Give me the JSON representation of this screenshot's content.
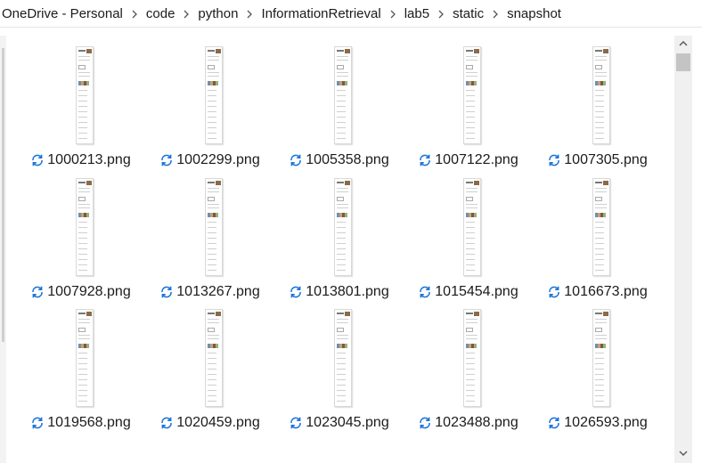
{
  "breadcrumb": {
    "items": [
      "OneDrive - Personal",
      "code",
      "python",
      "InformationRetrieval",
      "lab5",
      "static",
      "snapshot"
    ]
  },
  "files": [
    {
      "name": "1000213.png"
    },
    {
      "name": "1002299.png"
    },
    {
      "name": "1005358.png"
    },
    {
      "name": "1007122.png"
    },
    {
      "name": "1007305.png"
    },
    {
      "name": "1007928.png"
    },
    {
      "name": "1013267.png"
    },
    {
      "name": "1013801.png"
    },
    {
      "name": "1015454.png"
    },
    {
      "name": "1016673.png"
    },
    {
      "name": "1019568.png"
    },
    {
      "name": "1020459.png"
    },
    {
      "name": "1023045.png"
    },
    {
      "name": "1023488.png"
    },
    {
      "name": "1026593.png"
    }
  ],
  "icons": {
    "sync": "sync-pending-icon",
    "separator": "chevron-right-icon"
  },
  "colors": {
    "sync_icon": "#1a73d9",
    "text": "#1b1b1b"
  }
}
